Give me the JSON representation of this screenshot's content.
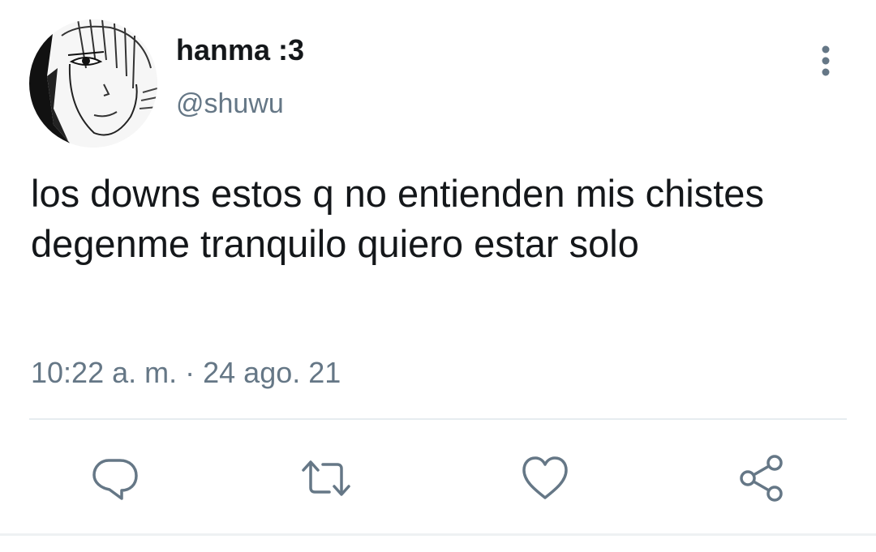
{
  "tweet": {
    "author": {
      "display_name": "hanma :3",
      "handle": "@shuwu",
      "avatar_icon": "anime-avatar"
    },
    "text": "los downs estos q no entienden mis chistes degenme tranquilo quiero estar solo",
    "time": "10:22 a. m.",
    "separator": "·",
    "date": "24 ago. 21"
  },
  "actions": [
    {
      "icon": "reply-icon"
    },
    {
      "icon": "retweet-icon"
    },
    {
      "icon": "like-icon"
    },
    {
      "icon": "share-icon"
    }
  ],
  "menu_icon": "more-vertical-icon",
  "colors": {
    "text": "#14171a",
    "secondary": "#657786",
    "divider": "#e6ecf0"
  }
}
